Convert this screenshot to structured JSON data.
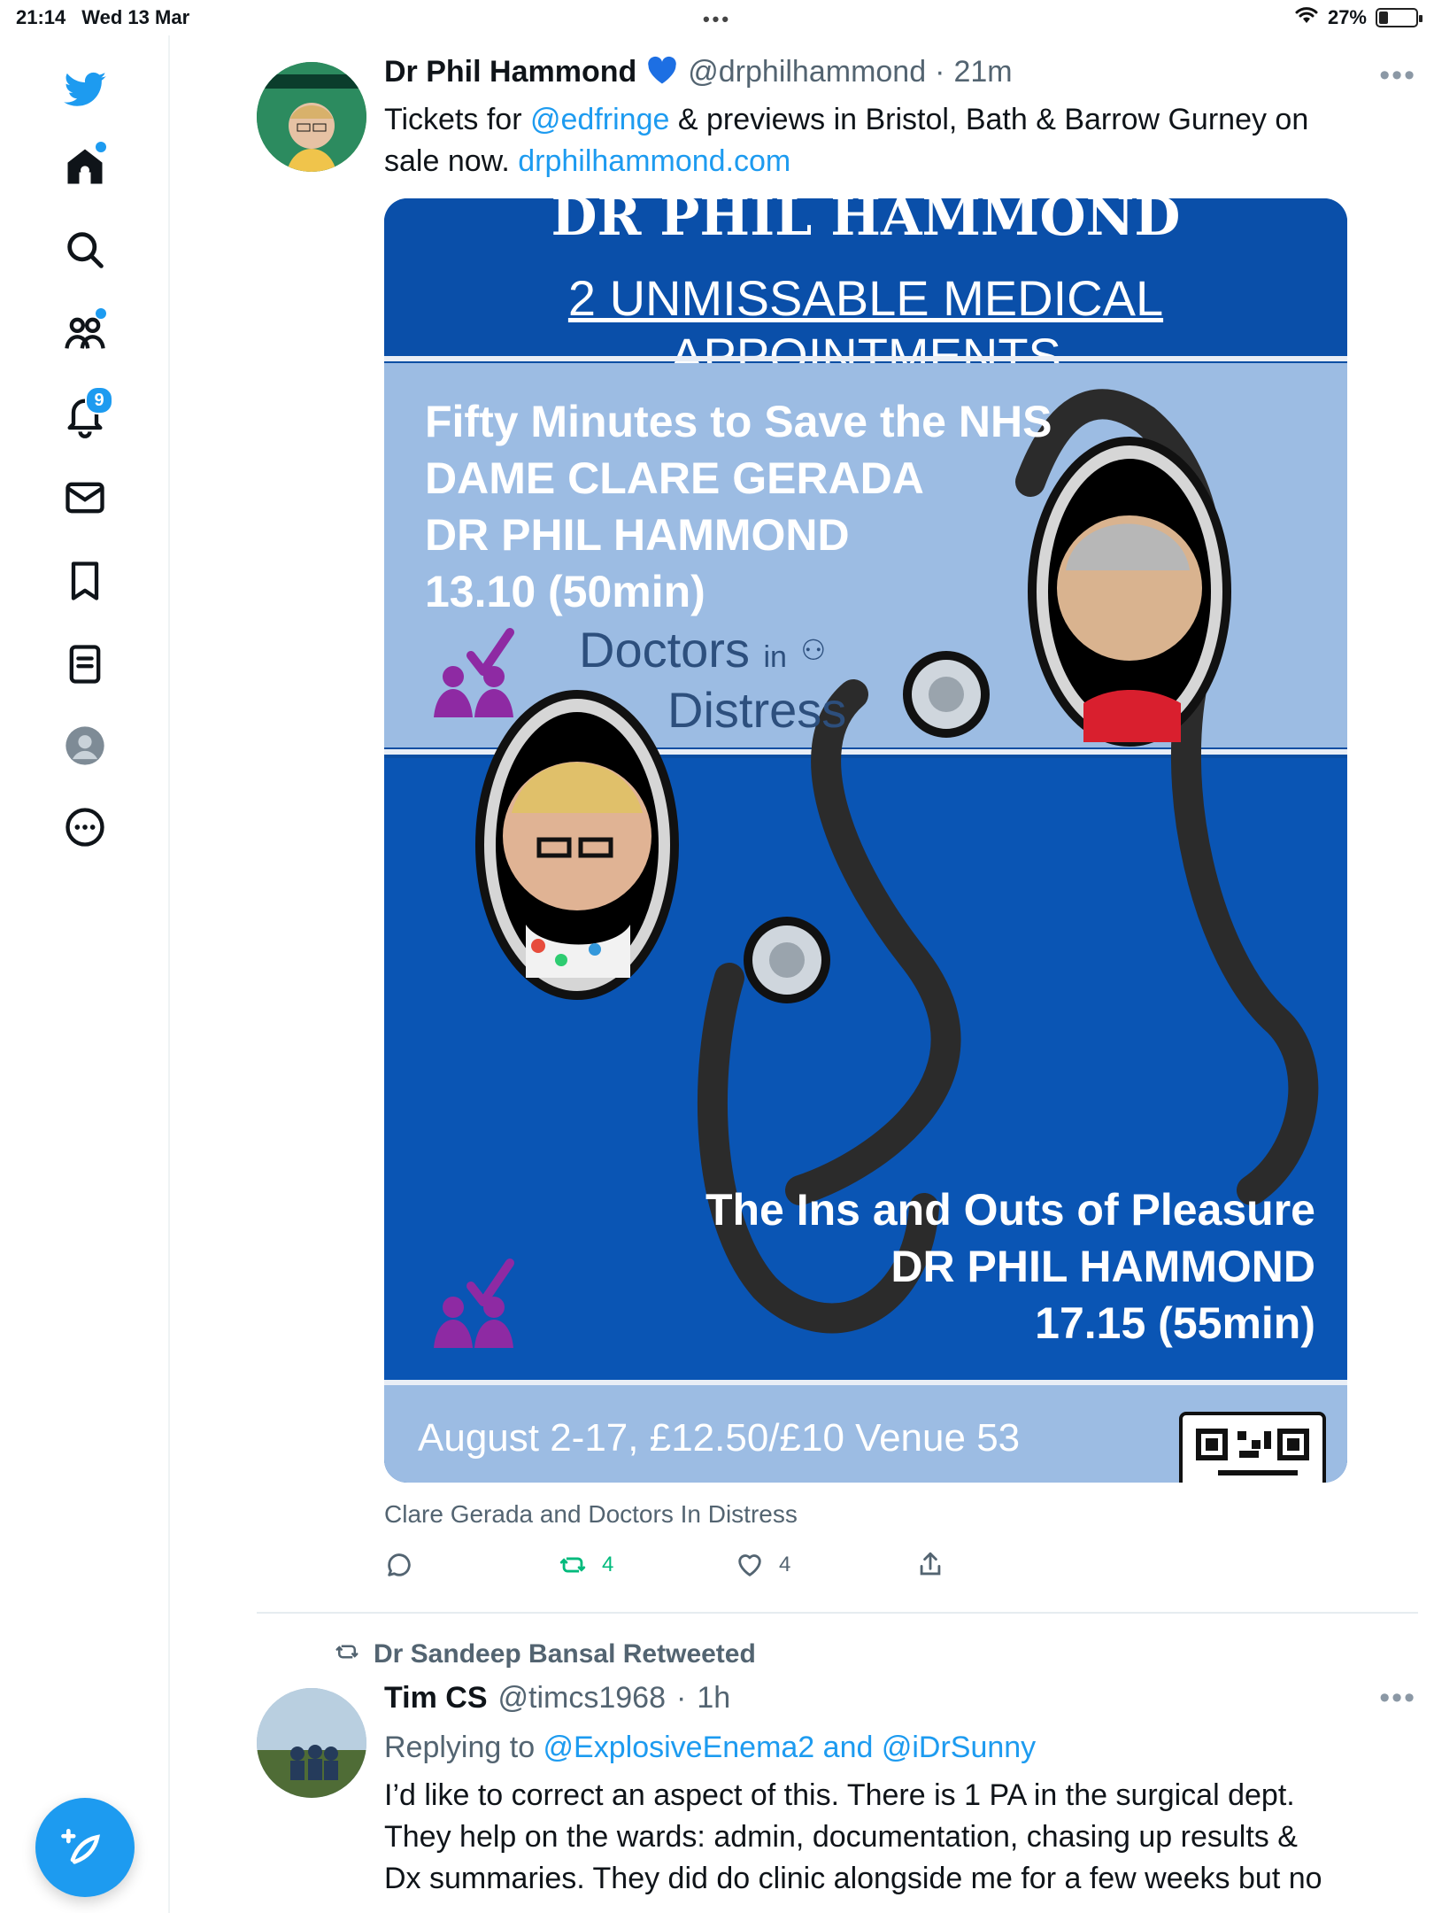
{
  "status": {
    "time": "21:14",
    "date": "Wed 13 Mar",
    "dots": "•••",
    "battery": "27%"
  },
  "nav": {
    "notifications_count": "9"
  },
  "tweet1": {
    "name": "Dr Phil Hammond",
    "handle": "@drphilhammond",
    "time": "21m",
    "text_pre": "Tickets for ",
    "mention": "@edfringe",
    "text_mid": " & previews in Bristol, Bath & Barrow Gurney on sale now. ",
    "link": "drphilhammond.com",
    "media": {
      "top_title": "DR PHIL HAMMOND",
      "subtitle": "2 UNMISSABLE MEDICAL APPOINTMENTS",
      "block1_lines": [
        "Fifty Minutes to Save the NHS",
        "DAME CLARE GERADA",
        "DR PHIL HAMMOND",
        "13.10 (50min)"
      ],
      "doctors_in_distress": [
        "Doctors",
        "in",
        "Distress"
      ],
      "block2_lines": [
        "The Ins and Outs of Pleasure",
        "DR PHIL HAMMOND",
        "17.15 (55min)"
      ],
      "bottom_text": "August 2-17, £12.50/£10 Venue 53"
    },
    "caption": "Clare Gerada and Doctors In Distress",
    "retweets": "4",
    "likes": "4"
  },
  "tweet2": {
    "retweeted_by": "Dr Sandeep Bansal Retweeted",
    "name": "Tim CS",
    "handle": "@timcs1968",
    "time": "1h",
    "replying_label": "Replying to ",
    "replying_to": "@ExplosiveEnema2 and @iDrSunny",
    "text": "I’d like to correct an aspect of this. There is 1 PA in the surgical dept. They help on the wards: admin, documentation, chasing up results & Dx summaries. They did do clinic alongside me for a few weeks but no"
  }
}
